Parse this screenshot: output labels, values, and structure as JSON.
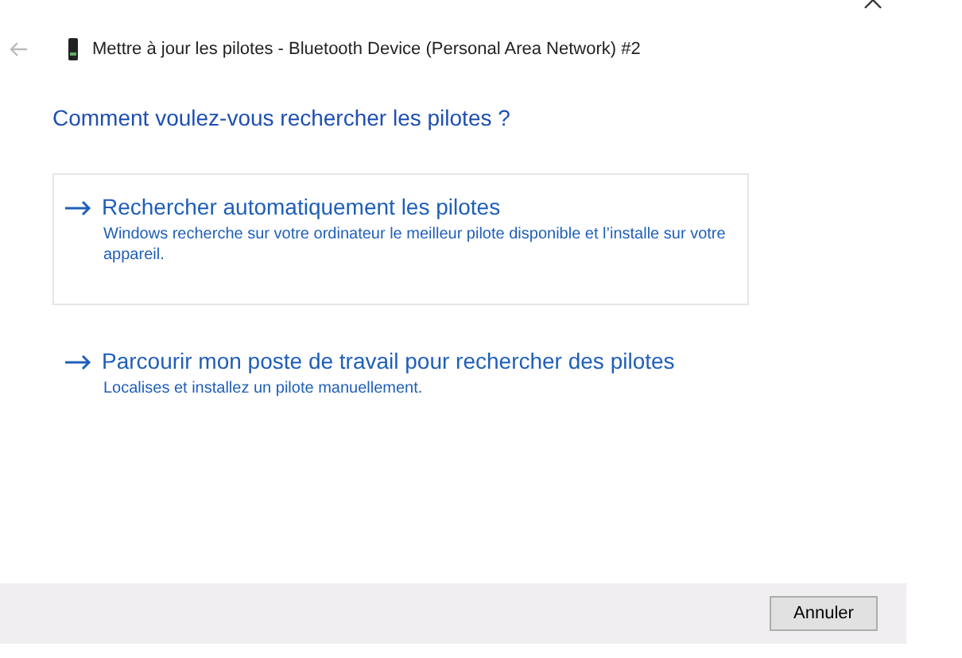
{
  "window": {
    "title": "Mettre à jour les pilotes - Bluetooth Device (Personal Area Network) #2"
  },
  "heading": "Comment voulez-vous rechercher les pilotes ?",
  "options": [
    {
      "title": "Rechercher automatiquement les pilotes",
      "description": "Windows recherche sur votre ordinateur le meilleur pilote disponible et l’installe sur votre appareil.",
      "highlighted": true
    },
    {
      "title": "Parcourir mon poste de travail pour rechercher des pilotes",
      "description": "Localises et installez un pilote manuellement.",
      "highlighted": false
    }
  ],
  "buttons": [
    "Annuler"
  ]
}
